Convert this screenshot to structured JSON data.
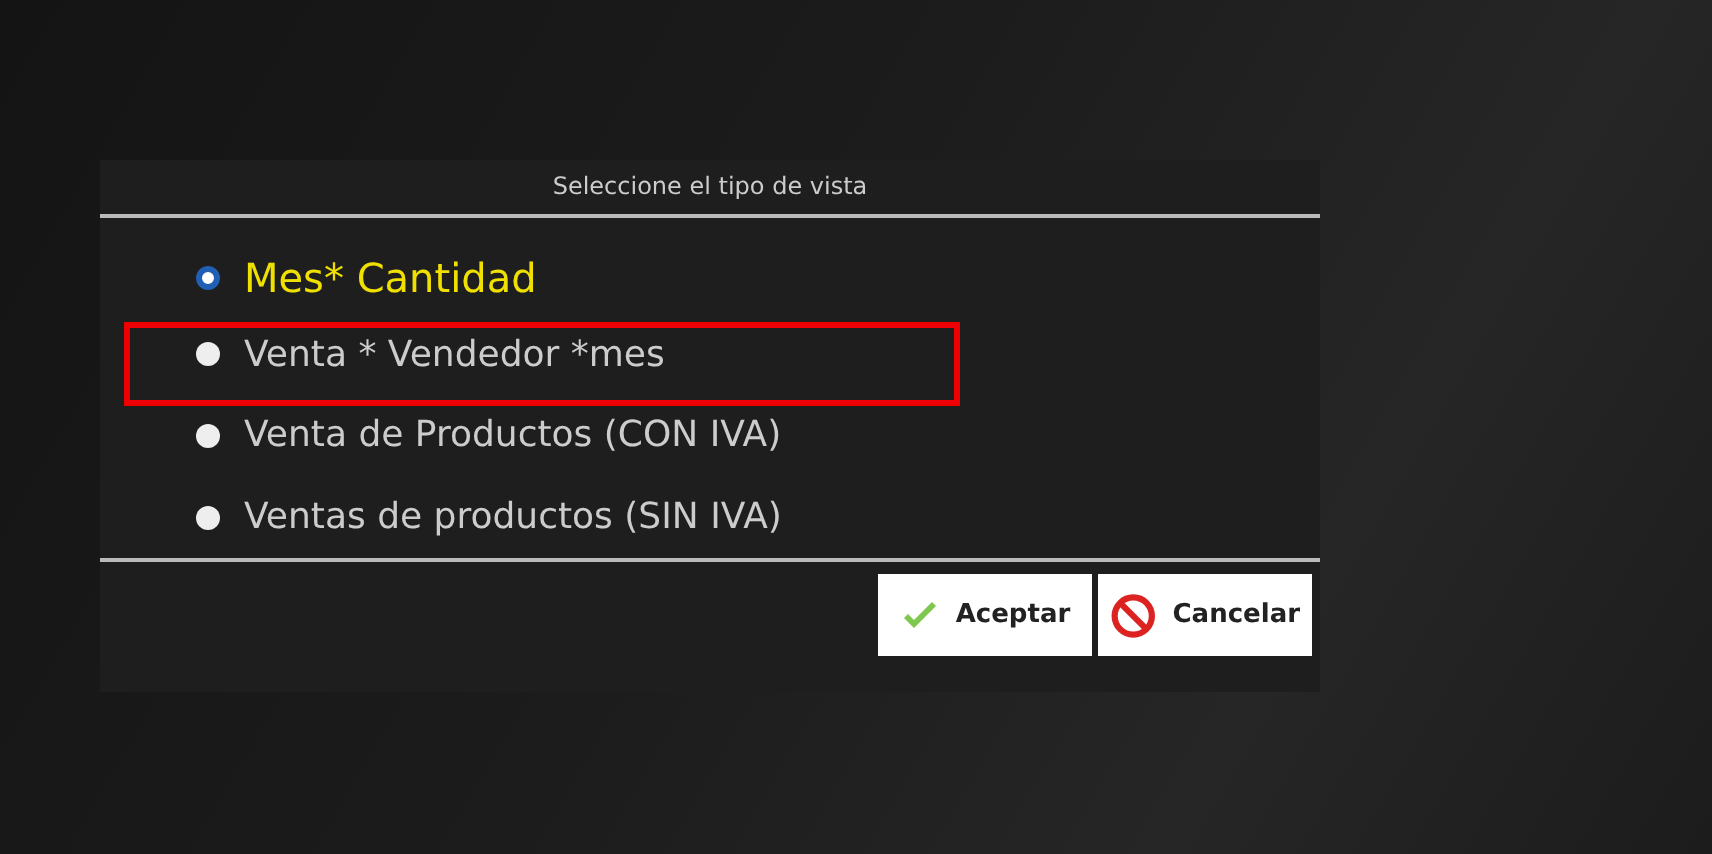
{
  "dialog": {
    "title": "Seleccione el tipo de vista",
    "options": [
      {
        "label": "Mes* Cantidad",
        "selected": true,
        "highlighted": false
      },
      {
        "label": "Venta * Vendedor *mes",
        "selected": false,
        "highlighted": true
      },
      {
        "label": "Venta de Productos (CON IVA)",
        "selected": false,
        "highlighted": false
      },
      {
        "label": "Ventas de productos (SIN IVA)",
        "selected": false,
        "highlighted": false
      }
    ],
    "buttons": [
      {
        "label": "Aceptar",
        "kind": "accept"
      },
      {
        "label": "Cancelar",
        "kind": "cancel"
      }
    ]
  }
}
